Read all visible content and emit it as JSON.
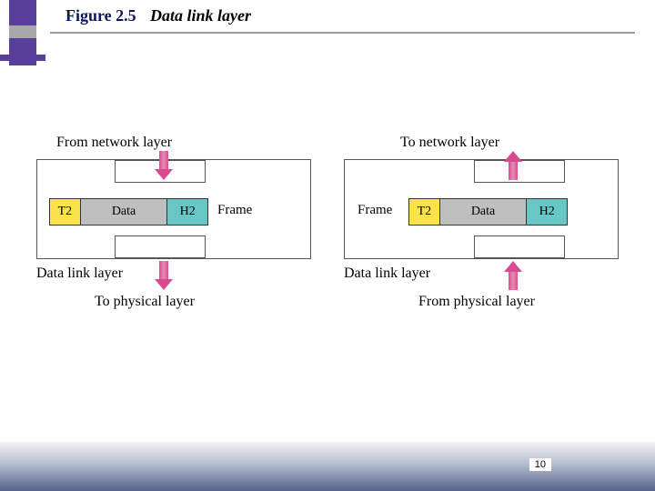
{
  "figure": {
    "label": "Figure 2.5",
    "title": "Data link layer"
  },
  "labels": {
    "from_network": "From network layer",
    "to_network": "To network layer",
    "to_physical": "To physical layer",
    "from_physical": "From physical layer",
    "dll_left": "Data link layer",
    "dll_right": "Data link layer",
    "frame_left": "Frame",
    "frame_right": "Frame"
  },
  "packet": {
    "trailer": "T2",
    "payload": "Data",
    "header": "H2"
  },
  "page": "10"
}
